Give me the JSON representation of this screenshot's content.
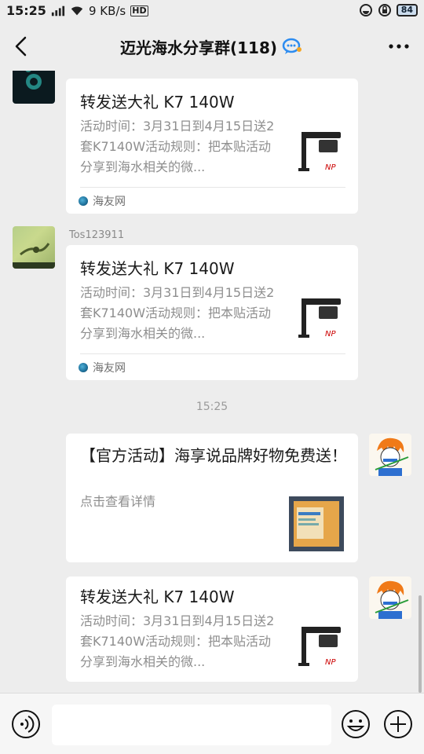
{
  "status_bar": {
    "time": "15:25",
    "network_speed": "9 KB/s",
    "hd": "HD",
    "battery": "84"
  },
  "header": {
    "title": "迈光海水分享群(118)"
  },
  "messages": [
    {
      "title": "转发送大礼 K7 140W",
      "desc": "活动时间：3月31日到4月15日送2套K7140W活动规则：把本贴活动分享到海水相关的微...",
      "source": "海友网"
    },
    {
      "sender": "Tos123911",
      "title": "转发送大礼 K7 140W",
      "desc": "活动时间：3月31日到4月15日送2套K7140W活动规则：把本贴活动分享到海水相关的微...",
      "source": "海友网"
    },
    {
      "timestamp": "15:25"
    },
    {
      "title": "【官方活动】海享说品牌好物免费送！",
      "desc": "点击查看详情"
    },
    {
      "title": "转发送大礼 K7 140W",
      "desc": "活动时间：3月31日到4月15日送2套K7140W活动规则：把本贴活动分享到海水相关的微..."
    }
  ],
  "colors": {
    "background": "#ededed",
    "card": "#ffffff",
    "muted_text": "#8e8e8e",
    "input_bar": "#f6f6f6"
  },
  "icons": [
    "back-arrow-icon",
    "more-icon",
    "group-chat-icon",
    "voice-icon",
    "emoji-icon",
    "plus-icon",
    "signal-icon",
    "wifi-icon",
    "alarm-icon",
    "lock-icon"
  ]
}
